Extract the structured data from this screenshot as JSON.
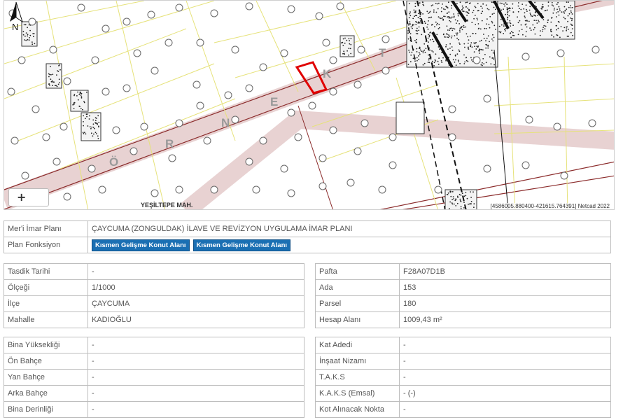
{
  "map": {
    "neighborhood_label": "YEŞİLTEPE MAH.",
    "street_letters": [
      "Ö",
      "R",
      "N",
      "E",
      "K",
      "T"
    ],
    "coordinate_readout": "[4586005.880400-421615.764391] Netcad 2022",
    "north_label": "N",
    "zoom_in": "+"
  },
  "plan": {
    "name_label": "Mer'i İmar Planı",
    "name_value": "ÇAYCUMA (ZONGULDAK) İLAVE VE REVİZYON UYGULAMA İMAR PLANI",
    "function_label": "Plan Fonksiyon",
    "functions": [
      "Kısmen Gelişme Konut Alanı",
      "Kısmen Gelişme Konut Alanı"
    ]
  },
  "info_left": [
    {
      "label": "Tasdik Tarihi",
      "value": "-"
    },
    {
      "label": "Ölçeği",
      "value": "1/1000"
    },
    {
      "label": "İlçe",
      "value": "ÇAYCUMA"
    },
    {
      "label": "Mahalle",
      "value": "KADIOĞLU"
    }
  ],
  "info_right": [
    {
      "label": "Pafta",
      "value": "F28A07D1B"
    },
    {
      "label": "Ada",
      "value": "153"
    },
    {
      "label": "Parsel",
      "value": "180"
    },
    {
      "label": "Hesap Alanı",
      "value": "1009,43 m²"
    }
  ],
  "build_left": [
    {
      "label": "Bina Yüksekliği",
      "value": "-"
    },
    {
      "label": "Ön Bahçe",
      "value": "-"
    },
    {
      "label": "Yan Bahçe",
      "value": "-"
    },
    {
      "label": "Arka Bahçe",
      "value": "-"
    },
    {
      "label": "Bina Derinliği",
      "value": "-"
    }
  ],
  "build_right": [
    {
      "label": "Kat Adedi",
      "value": "-"
    },
    {
      "label": "İnşaat Nizamı",
      "value": "-"
    },
    {
      "label": "T.A.K.S",
      "value": "-"
    },
    {
      "label": "K.A.K.S (Emsal)",
      "value": "- (-)"
    },
    {
      "label": "Kot Alınacak Nokta",
      "value": "-"
    }
  ]
}
